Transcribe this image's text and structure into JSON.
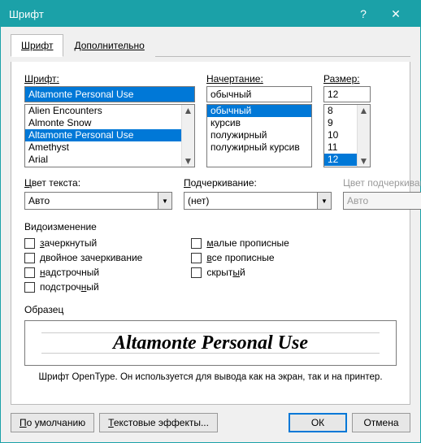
{
  "titlebar": {
    "title": "Шрифт",
    "help": "?",
    "close": "✕"
  },
  "tabs": {
    "font": "Шрифт",
    "advanced": "Дополнительно"
  },
  "labels": {
    "font": "Шрифт:",
    "style": "Начертание:",
    "size": "Размер:",
    "color_u": "Ц",
    "color_rest": "вет текста:",
    "underline_u": "П",
    "underline_rest": "одчеркивание:",
    "ucolor": "Цвет подчеркивания:",
    "effects": "Видоизменение",
    "preview": "Образец"
  },
  "font": {
    "value": "Altamonte Personal Use",
    "items": [
      "Alien Encounters",
      "Almonte Snow",
      "Altamonte Personal Use",
      "Amethyst",
      "Arial"
    ],
    "selectedIndex": 2
  },
  "style": {
    "value": "обычный",
    "items": [
      "обычный",
      "курсив",
      "полужирный",
      "полужирный курсив"
    ],
    "selectedIndex": 0
  },
  "size": {
    "value": "12",
    "items": [
      "8",
      "9",
      "10",
      "11",
      "12"
    ],
    "selectedIndex": 4
  },
  "color": "Авто",
  "underline": "(нет)",
  "underline_color": "Авто",
  "effects": {
    "left": [
      {
        "u": "з",
        "rest": "ачеркнутый"
      },
      {
        "u": "д",
        "rest": "войное зачеркивание"
      },
      {
        "u": "н",
        "rest": "адстрочный"
      },
      {
        "plain": "подстроч",
        "u": "н",
        "rest": "ый"
      }
    ],
    "right": [
      {
        "u": "м",
        "rest": "алые прописные"
      },
      {
        "u": "в",
        "rest": "се прописные"
      },
      {
        "plain": "скрыт",
        "u": "ы",
        "rest": "й"
      }
    ]
  },
  "preview_text": "Altamonte Personal Use",
  "hint": "Шрифт OpenType. Он используется для вывода как на экран, так и на принтер.",
  "buttons": {
    "default_u": "П",
    "default_rest": "о умолчанию",
    "effects_u": "Т",
    "effects_rest": "екстовые эффекты...",
    "ok": "ОК",
    "cancel": "Отмена"
  }
}
